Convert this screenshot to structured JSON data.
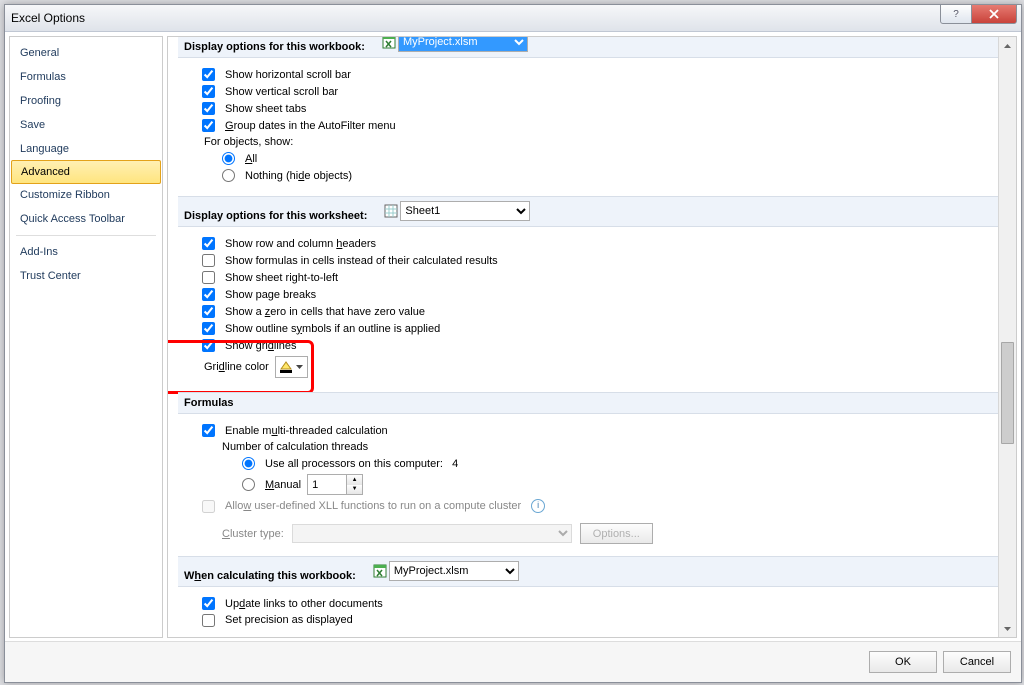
{
  "titlebar": {
    "title": "Excel Options"
  },
  "sidebar": {
    "items": [
      {
        "label": "General"
      },
      {
        "label": "Formulas"
      },
      {
        "label": "Proofing"
      },
      {
        "label": "Save"
      },
      {
        "label": "Language"
      },
      {
        "label": "Advanced",
        "selected": true
      },
      {
        "label": "Customize Ribbon"
      },
      {
        "label": "Quick Access Toolbar"
      },
      {
        "label": "Add-Ins"
      },
      {
        "label": "Trust Center"
      }
    ]
  },
  "sec_workbook_disp": {
    "title_part": "Display options for this workbook:",
    "workbook_name": "MyProject.xlsm",
    "show_hscroll": "Show horizontal scroll bar",
    "show_vscroll": "Show vertical scroll bar",
    "show_tabs": "Show sheet tabs",
    "group_dates_pre": "",
    "group_dates_u": "G",
    "group_dates_post": "roup dates in the AutoFilter menu",
    "for_objects": "For objects, show:",
    "all_u": "A",
    "all_post": "ll",
    "nothing_pre": "Nothing (hi",
    "nothing_u": "d",
    "nothing_post": "e objects)"
  },
  "sec_worksheet_disp": {
    "title": "Display options for this worksheet:",
    "sheet_name": "Sheet1",
    "row_col_pre": "Show row and column ",
    "row_col_u": "h",
    "row_col_post": "eaders",
    "formulas_line": "Show formulas in cells instead of their calculated results",
    "rtl_line": "Show sheet right-to-left",
    "page_breaks": "Show page breaks",
    "zeros_pre": "Show a ",
    "zeros_u": "z",
    "zeros_post": "ero in cells that have zero value",
    "outline_pre": "Show outline s",
    "outline_u": "y",
    "outline_post": "mbols if an outline is applied",
    "gridlines_pre": "Show gri",
    "gridlines_u": "d",
    "gridlines_post": "lines",
    "gridline_color_pre": "Gri",
    "gridline_color_u": "d",
    "gridline_color_post": "line color"
  },
  "sec_formulas": {
    "title": "Formulas",
    "enable_pre": "Enable m",
    "enable_u": "u",
    "enable_post": "lti-threaded calculation",
    "threads_label": "Number of calculation threads",
    "use_all_pre": "Use all processors on this computer:",
    "use_all_count": "4",
    "manual_u": "M",
    "manual_post": "anual",
    "manual_value": "1",
    "allow_xll_pre": "Allo",
    "allow_xll_u": "w",
    "allow_xll_post": " user-defined XLL functions to run on a compute cluster",
    "cluster_pre": "",
    "cluster_u": "C",
    "cluster_post": "luster type:",
    "options_btn": "Options..."
  },
  "sec_calc_when": {
    "title_pre": "W",
    "title_u": "h",
    "title_post": "en calculating this workbook:",
    "workbook_name": "MyProject.xlsm",
    "update_pre": "Up",
    "update_u": "d",
    "update_post": "ate links to other documents",
    "precision_line": "Set precision as displayed"
  },
  "footer": {
    "ok": "OK",
    "cancel": "Cancel"
  }
}
